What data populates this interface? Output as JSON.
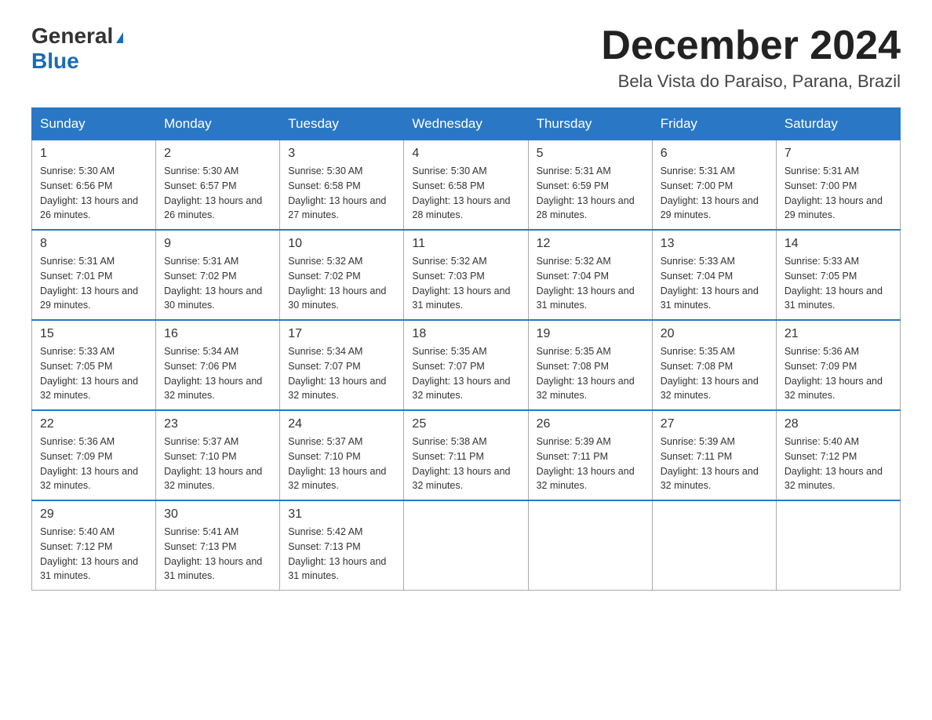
{
  "header": {
    "logo_general": "General",
    "logo_blue": "Blue",
    "month_year": "December 2024",
    "location": "Bela Vista do Paraiso, Parana, Brazil"
  },
  "days_of_week": [
    "Sunday",
    "Monday",
    "Tuesday",
    "Wednesday",
    "Thursday",
    "Friday",
    "Saturday"
  ],
  "weeks": [
    [
      {
        "day": "1",
        "sunrise": "5:30 AM",
        "sunset": "6:56 PM",
        "daylight": "13 hours and 26 minutes."
      },
      {
        "day": "2",
        "sunrise": "5:30 AM",
        "sunset": "6:57 PM",
        "daylight": "13 hours and 26 minutes."
      },
      {
        "day": "3",
        "sunrise": "5:30 AM",
        "sunset": "6:58 PM",
        "daylight": "13 hours and 27 minutes."
      },
      {
        "day": "4",
        "sunrise": "5:30 AM",
        "sunset": "6:58 PM",
        "daylight": "13 hours and 28 minutes."
      },
      {
        "day": "5",
        "sunrise": "5:31 AM",
        "sunset": "6:59 PM",
        "daylight": "13 hours and 28 minutes."
      },
      {
        "day": "6",
        "sunrise": "5:31 AM",
        "sunset": "7:00 PM",
        "daylight": "13 hours and 29 minutes."
      },
      {
        "day": "7",
        "sunrise": "5:31 AM",
        "sunset": "7:00 PM",
        "daylight": "13 hours and 29 minutes."
      }
    ],
    [
      {
        "day": "8",
        "sunrise": "5:31 AM",
        "sunset": "7:01 PM",
        "daylight": "13 hours and 29 minutes."
      },
      {
        "day": "9",
        "sunrise": "5:31 AM",
        "sunset": "7:02 PM",
        "daylight": "13 hours and 30 minutes."
      },
      {
        "day": "10",
        "sunrise": "5:32 AM",
        "sunset": "7:02 PM",
        "daylight": "13 hours and 30 minutes."
      },
      {
        "day": "11",
        "sunrise": "5:32 AM",
        "sunset": "7:03 PM",
        "daylight": "13 hours and 31 minutes."
      },
      {
        "day": "12",
        "sunrise": "5:32 AM",
        "sunset": "7:04 PM",
        "daylight": "13 hours and 31 minutes."
      },
      {
        "day": "13",
        "sunrise": "5:33 AM",
        "sunset": "7:04 PM",
        "daylight": "13 hours and 31 minutes."
      },
      {
        "day": "14",
        "sunrise": "5:33 AM",
        "sunset": "7:05 PM",
        "daylight": "13 hours and 31 minutes."
      }
    ],
    [
      {
        "day": "15",
        "sunrise": "5:33 AM",
        "sunset": "7:05 PM",
        "daylight": "13 hours and 32 minutes."
      },
      {
        "day": "16",
        "sunrise": "5:34 AM",
        "sunset": "7:06 PM",
        "daylight": "13 hours and 32 minutes."
      },
      {
        "day": "17",
        "sunrise": "5:34 AM",
        "sunset": "7:07 PM",
        "daylight": "13 hours and 32 minutes."
      },
      {
        "day": "18",
        "sunrise": "5:35 AM",
        "sunset": "7:07 PM",
        "daylight": "13 hours and 32 minutes."
      },
      {
        "day": "19",
        "sunrise": "5:35 AM",
        "sunset": "7:08 PM",
        "daylight": "13 hours and 32 minutes."
      },
      {
        "day": "20",
        "sunrise": "5:35 AM",
        "sunset": "7:08 PM",
        "daylight": "13 hours and 32 minutes."
      },
      {
        "day": "21",
        "sunrise": "5:36 AM",
        "sunset": "7:09 PM",
        "daylight": "13 hours and 32 minutes."
      }
    ],
    [
      {
        "day": "22",
        "sunrise": "5:36 AM",
        "sunset": "7:09 PM",
        "daylight": "13 hours and 32 minutes."
      },
      {
        "day": "23",
        "sunrise": "5:37 AM",
        "sunset": "7:10 PM",
        "daylight": "13 hours and 32 minutes."
      },
      {
        "day": "24",
        "sunrise": "5:37 AM",
        "sunset": "7:10 PM",
        "daylight": "13 hours and 32 minutes."
      },
      {
        "day": "25",
        "sunrise": "5:38 AM",
        "sunset": "7:11 PM",
        "daylight": "13 hours and 32 minutes."
      },
      {
        "day": "26",
        "sunrise": "5:39 AM",
        "sunset": "7:11 PM",
        "daylight": "13 hours and 32 minutes."
      },
      {
        "day": "27",
        "sunrise": "5:39 AM",
        "sunset": "7:11 PM",
        "daylight": "13 hours and 32 minutes."
      },
      {
        "day": "28",
        "sunrise": "5:40 AM",
        "sunset": "7:12 PM",
        "daylight": "13 hours and 32 minutes."
      }
    ],
    [
      {
        "day": "29",
        "sunrise": "5:40 AM",
        "sunset": "7:12 PM",
        "daylight": "13 hours and 31 minutes."
      },
      {
        "day": "30",
        "sunrise": "5:41 AM",
        "sunset": "7:13 PM",
        "daylight": "13 hours and 31 minutes."
      },
      {
        "day": "31",
        "sunrise": "5:42 AM",
        "sunset": "7:13 PM",
        "daylight": "13 hours and 31 minutes."
      },
      null,
      null,
      null,
      null
    ]
  ]
}
